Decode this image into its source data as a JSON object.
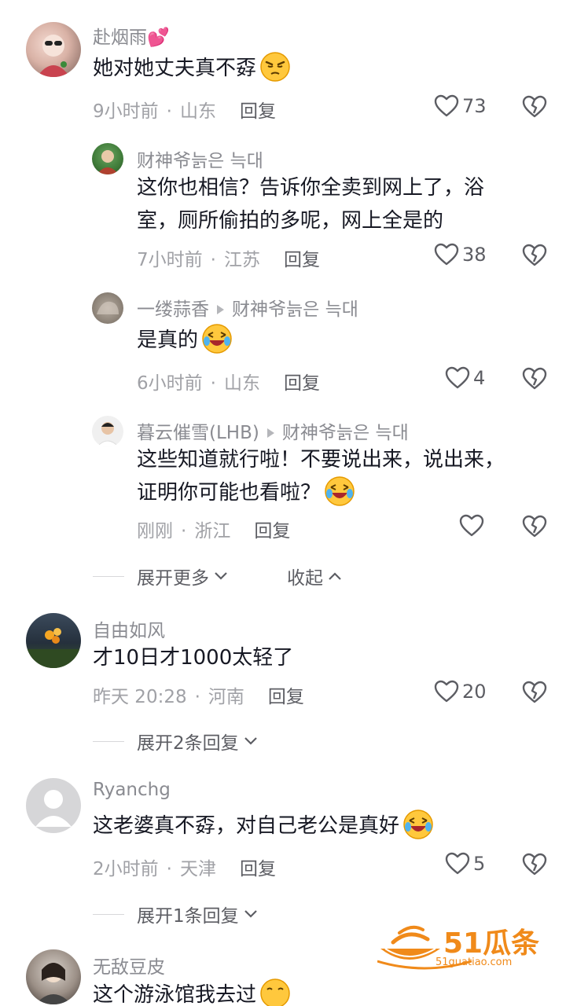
{
  "comments": [
    {
      "username": "赴烟雨💕",
      "text": "她对她丈夫真不孬",
      "time": "9小时前",
      "location": "山东",
      "reply": "回复",
      "likes": "73"
    },
    {
      "username": "财神爷늙은 늑대",
      "text1": "这你也相信？告诉你全卖到网上了，浴",
      "text2": "室，厕所偷拍的多呢，网上全是的",
      "time": "7小时前",
      "location": "江苏",
      "reply": "回复",
      "likes": "38"
    },
    {
      "username": "一缕蒜香",
      "reply_to": "财神爷늙은 늑대",
      "text": "是真的",
      "time": "6小时前",
      "location": "山东",
      "reply": "回复",
      "likes": "4"
    },
    {
      "username": "暮云催雪(LHB)",
      "reply_to": "财神爷늙은 늑대",
      "text1": "这些知道就行啦！不要说出来，说出来，",
      "text2": "证明你可能也看啦？",
      "time": "刚刚",
      "location": "浙江",
      "reply": "回复",
      "likes": ""
    },
    {
      "username": "自由如风",
      "text": "才10日才1000太轻了",
      "time": "昨天 20:28",
      "location": "河南",
      "reply": "回复",
      "likes": "20"
    },
    {
      "username": "Ryanchg",
      "text": "这老婆真不孬，对自己老公是真好",
      "time": "2小时前",
      "location": "天津",
      "reply": "回复",
      "likes": "5"
    },
    {
      "username": "无敌豆皮",
      "text": "这个游泳馆我去过"
    }
  ],
  "expand_more": "展开更多",
  "collapse": "收起",
  "expand_2": "展开2条回复",
  "expand_1": "展开1条回复",
  "watermark": {
    "brand": "51瓜条",
    "url": "51guatiao.com"
  }
}
